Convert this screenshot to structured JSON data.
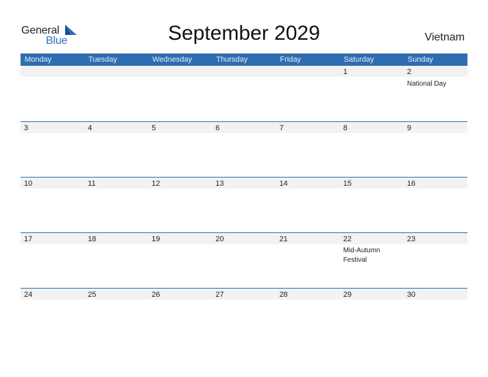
{
  "logo": {
    "word1": "General",
    "word2": "Blue",
    "accent_color": "#2a6ebb"
  },
  "title": "September 2029",
  "country": "Vietnam",
  "colors": {
    "header_bg": "#2e6db0",
    "row_band": "#f2f2f2"
  },
  "weekdays": [
    "Monday",
    "Tuesday",
    "Wednesday",
    "Thursday",
    "Friday",
    "Saturday",
    "Sunday"
  ],
  "weeks": [
    [
      {
        "day": ""
      },
      {
        "day": ""
      },
      {
        "day": ""
      },
      {
        "day": ""
      },
      {
        "day": ""
      },
      {
        "day": "1"
      },
      {
        "day": "2",
        "event": "National Day"
      }
    ],
    [
      {
        "day": "3"
      },
      {
        "day": "4"
      },
      {
        "day": "5"
      },
      {
        "day": "6"
      },
      {
        "day": "7"
      },
      {
        "day": "8"
      },
      {
        "day": "9"
      }
    ],
    [
      {
        "day": "10"
      },
      {
        "day": "11"
      },
      {
        "day": "12"
      },
      {
        "day": "13"
      },
      {
        "day": "14"
      },
      {
        "day": "15"
      },
      {
        "day": "16"
      }
    ],
    [
      {
        "day": "17"
      },
      {
        "day": "18"
      },
      {
        "day": "19"
      },
      {
        "day": "20"
      },
      {
        "day": "21"
      },
      {
        "day": "22",
        "event": "Mid-Autumn Festival"
      },
      {
        "day": "23"
      }
    ],
    [
      {
        "day": "24"
      },
      {
        "day": "25"
      },
      {
        "day": "26"
      },
      {
        "day": "27"
      },
      {
        "day": "28"
      },
      {
        "day": "29"
      },
      {
        "day": "30"
      }
    ]
  ]
}
